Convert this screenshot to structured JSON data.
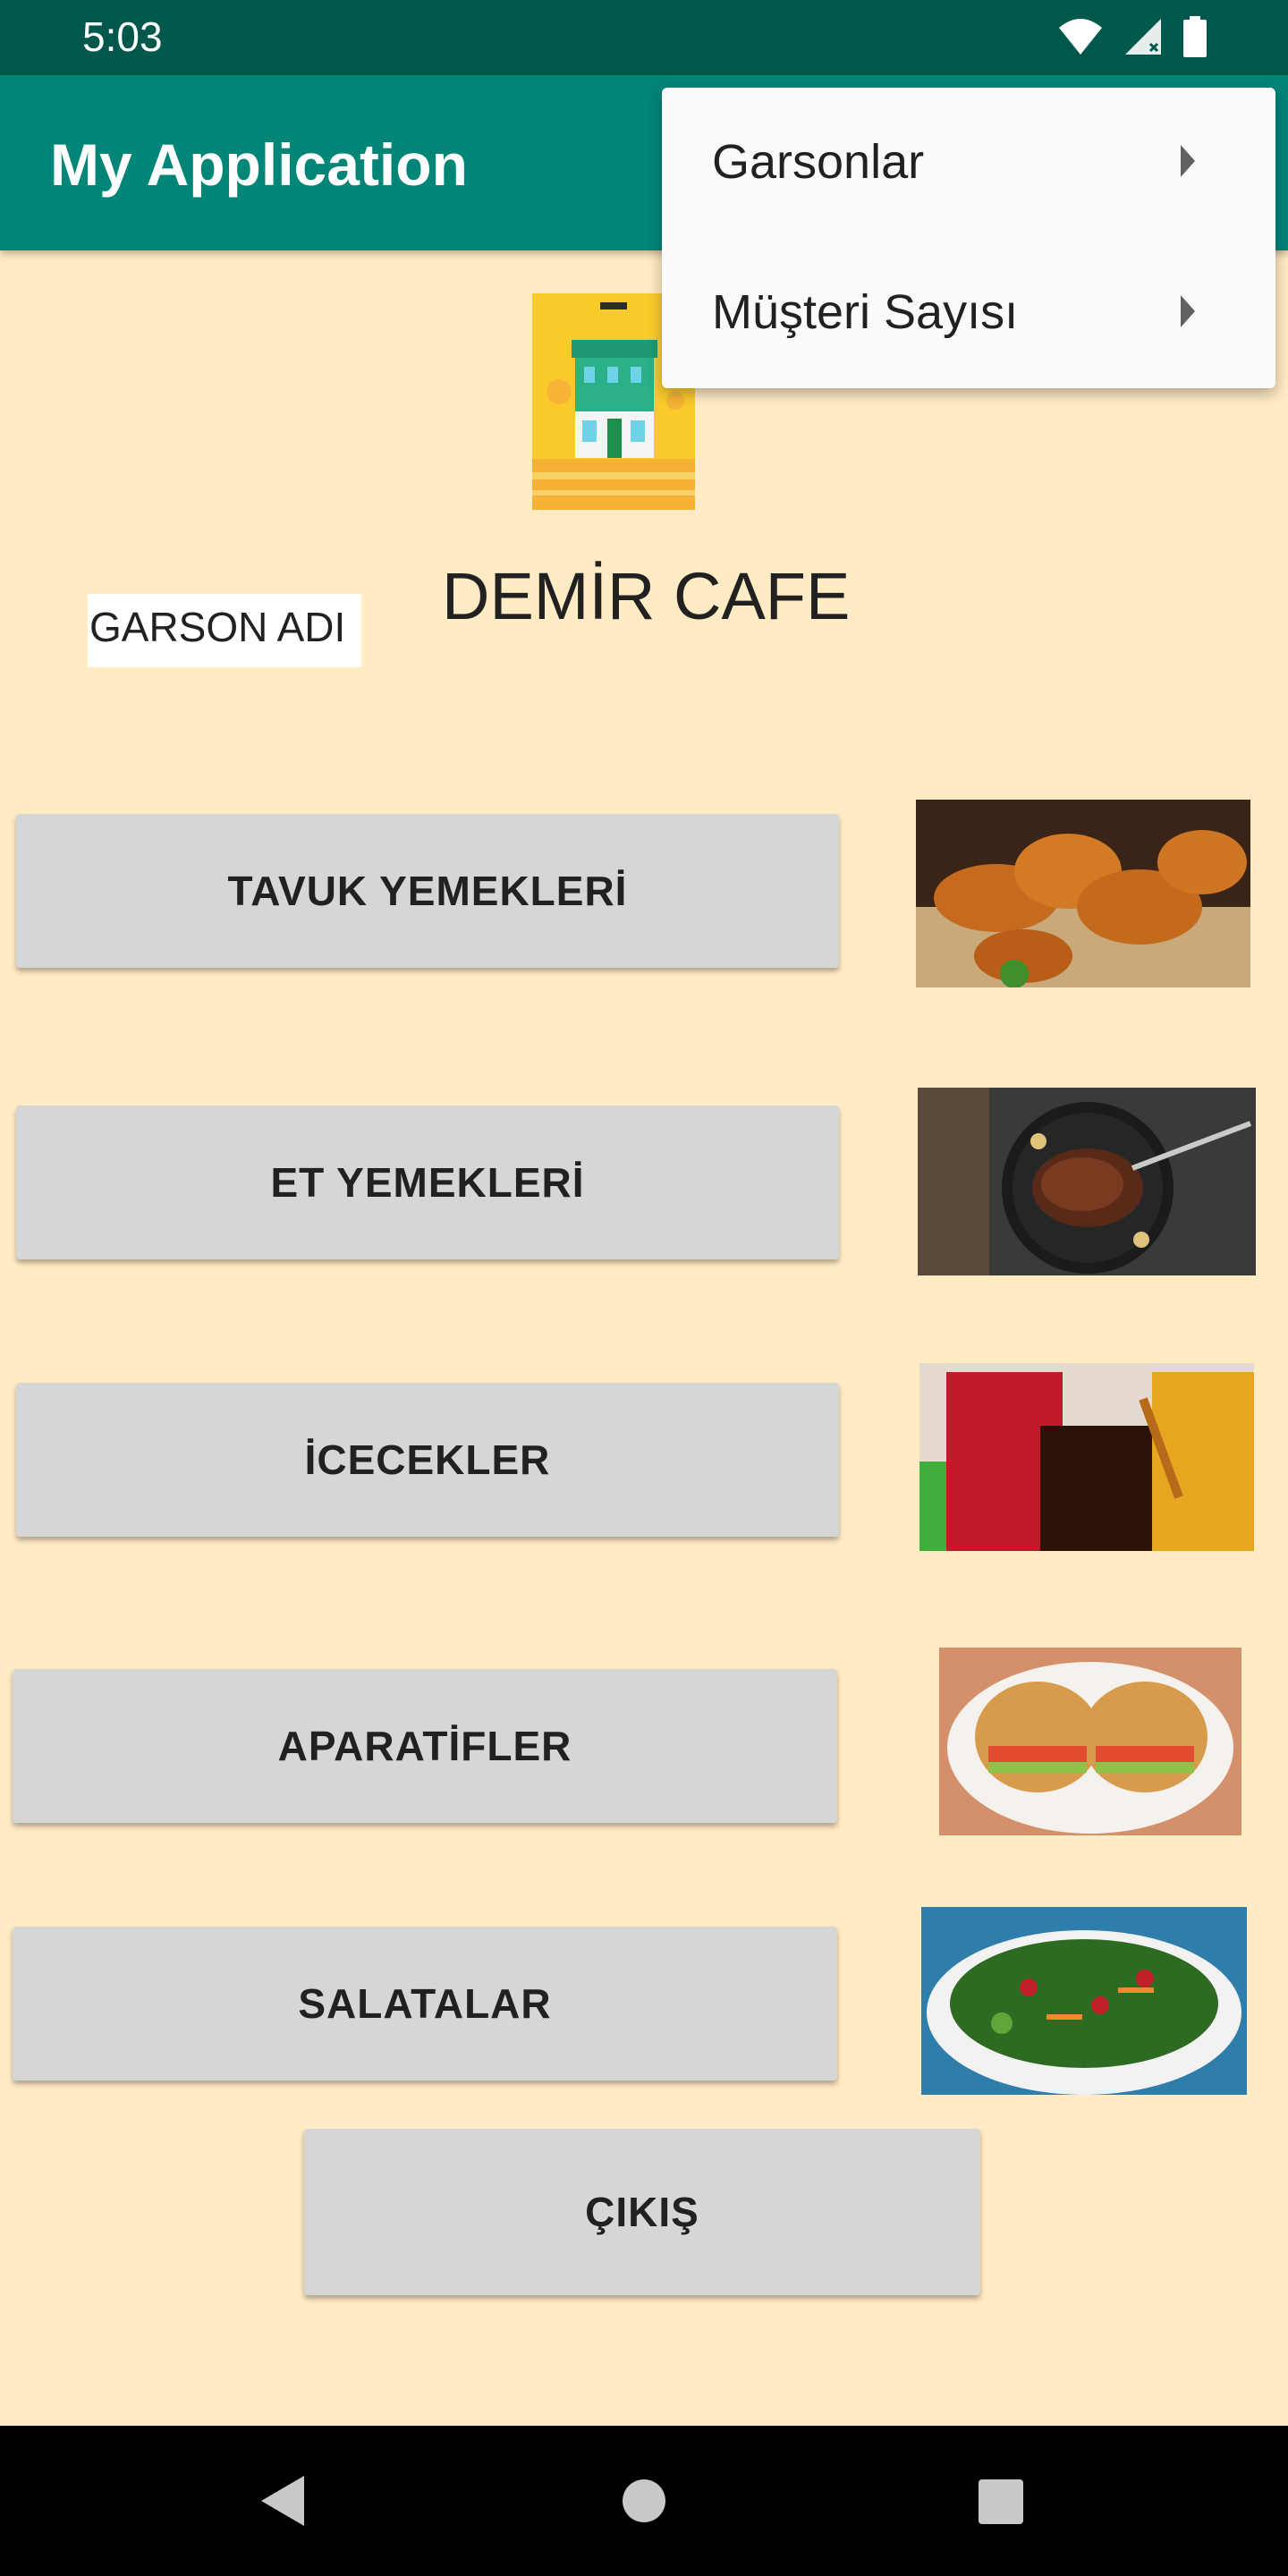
{
  "status_bar": {
    "time": "5:03",
    "icons": [
      "wifi-icon",
      "signal-icon",
      "battery-icon"
    ]
  },
  "app_bar": {
    "title": "My Application",
    "background": "#008577"
  },
  "overflow_menu": {
    "items": [
      {
        "label": "Garsonlar",
        "icon": "chevron-right-icon"
      },
      {
        "label": "Müşteri Sayısı",
        "icon": "chevron-right-icon"
      }
    ]
  },
  "main": {
    "logo": "cafe-building-logo",
    "waiter_field": "GARSON ADI",
    "cafe_title": "DEMİR CAFE",
    "buttons": [
      {
        "label": "TAVUK YEMEKLERİ",
        "image": "fried-chicken-image"
      },
      {
        "label": "ET YEMEKLERİ",
        "image": "steak-pan-image"
      },
      {
        "label": "İCECEKLER",
        "image": "drinks-image"
      },
      {
        "label": "APARATİFLER",
        "image": "sandwich-image"
      },
      {
        "label": "SALATALAR",
        "image": "salad-image"
      }
    ],
    "exit_button": "ÇIKIŞ",
    "background": "#FFEBC4"
  },
  "nav_bar": {
    "icons": [
      "back-icon",
      "home-icon",
      "recents-icon"
    ]
  }
}
